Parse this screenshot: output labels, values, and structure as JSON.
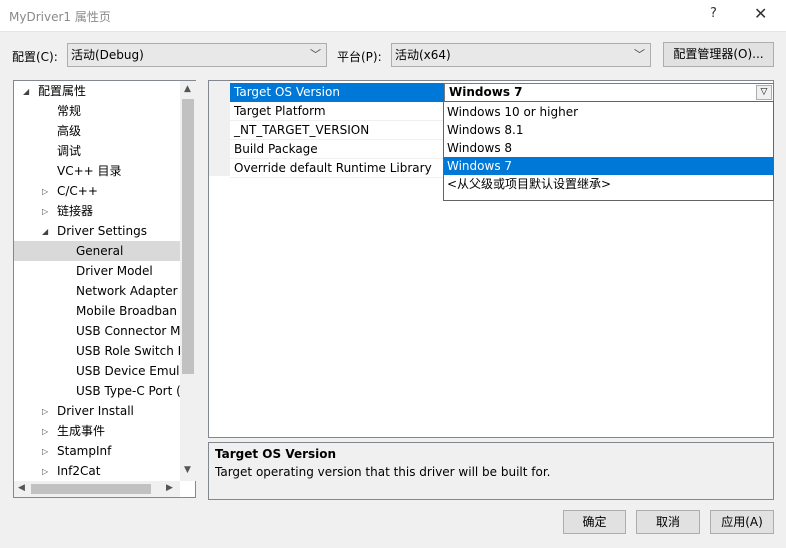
{
  "window": {
    "title": "MyDriver1 属性页",
    "help": "?",
    "close": "✕"
  },
  "config": {
    "label": "配置(C):",
    "value": "活动(Debug)"
  },
  "platform": {
    "label": "平台(P):",
    "value": "活动(x64)"
  },
  "config_manager_label": "配置管理器(O)...",
  "tree": {
    "items": [
      {
        "label": "配置属性",
        "expander": "◢"
      },
      {
        "label": "常规"
      },
      {
        "label": "高级"
      },
      {
        "label": "调试"
      },
      {
        "label": "VC++ 目录"
      },
      {
        "label": "C/C++",
        "expander": "▷"
      },
      {
        "label": "链接器",
        "expander": "▷"
      },
      {
        "label": "Driver Settings",
        "expander": "◢"
      },
      {
        "label": "General"
      },
      {
        "label": "Driver Model"
      },
      {
        "label": "Network Adapter"
      },
      {
        "label": "Mobile Broadban"
      },
      {
        "label": "USB Connector M"
      },
      {
        "label": "USB Role Switch D"
      },
      {
        "label": "USB Device Emula"
      },
      {
        "label": "USB Type-C Port ("
      },
      {
        "label": "Driver Install",
        "expander": "▷"
      },
      {
        "label": "生成事件",
        "expander": "▷"
      },
      {
        "label": "StampInf",
        "expander": "▷"
      },
      {
        "label": "Inf2Cat",
        "expander": "▷"
      }
    ]
  },
  "properties": [
    {
      "name": "Target OS Version",
      "value": "Windows 7"
    },
    {
      "name": "Target Platform"
    },
    {
      "name": "_NT_TARGET_VERSION"
    },
    {
      "name": "Build Package"
    },
    {
      "name": "Override default Runtime Library"
    }
  ],
  "dropdown": {
    "options": [
      "Windows 10 or higher",
      "Windows 8.1",
      "Windows 8",
      "Windows 7",
      "<从父级或项目默认设置继承>"
    ],
    "selected": "Windows 7"
  },
  "description": {
    "title": "Target OS Version",
    "text": "Target operating version that this driver will be built for."
  },
  "buttons": {
    "ok": "确定",
    "cancel": "取消",
    "apply": "应用(A)"
  },
  "colors": {
    "selection": "#0078d7",
    "tree_selection": "#d9d9d9"
  }
}
